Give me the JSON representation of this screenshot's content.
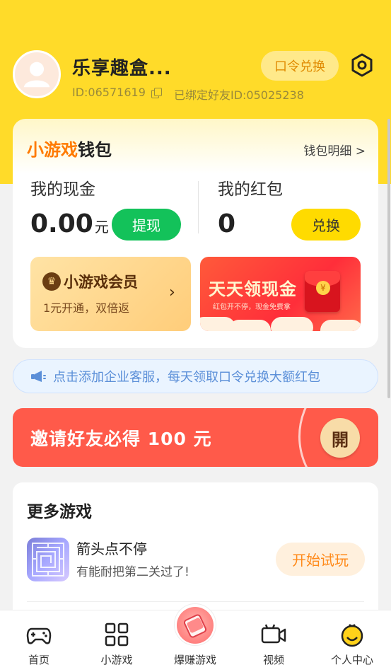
{
  "header": {
    "username": "乐享趣盒...",
    "user_id": "ID:06571619",
    "bound_friend": "已绑定好友ID:05025238",
    "code_exchange_label": "口令兑换"
  },
  "wallet": {
    "title_part1": "小游戏",
    "title_part2": "钱包",
    "detail_link": "钱包明细 >",
    "cash_label": "我的现金",
    "cash_value": "0.00",
    "cash_unit": "元",
    "withdraw_label": "提现",
    "redpack_label": "我的红包",
    "redpack_value": "0",
    "exchange_label": "兑换",
    "vip_title": "小游戏会员",
    "vip_subtitle": "1元开通，双倍返",
    "banner_title": "天天领现金",
    "banner_subtitle": "红包开不停，现金免费拿"
  },
  "notice": {
    "text": "点击添加企业客服，每天领取口令兑换大额红包"
  },
  "invite": {
    "text": "邀请好友必得 100 元",
    "open_label": "開"
  },
  "more_games": {
    "title": "更多游戏",
    "items": [
      {
        "name": "箭头点不停",
        "description": "有能耐把第二关过了!",
        "play_label": "开始试玩"
      }
    ]
  },
  "bottom_nav": {
    "items": [
      {
        "label": "首页",
        "icon": "gamepad-icon"
      },
      {
        "label": "小游戏",
        "icon": "grid-icon"
      },
      {
        "label": "爆赚游戏",
        "icon": "money-icon"
      },
      {
        "label": "视频",
        "icon": "video-camera-icon"
      },
      {
        "label": "个人中心",
        "icon": "smiley-face-icon"
      }
    ]
  },
  "colors": {
    "brand_yellow": "#ffdb29",
    "withdraw_green": "#13c25a",
    "invite_red": "#ff5a4a",
    "accent_orange": "#ff7a00"
  }
}
